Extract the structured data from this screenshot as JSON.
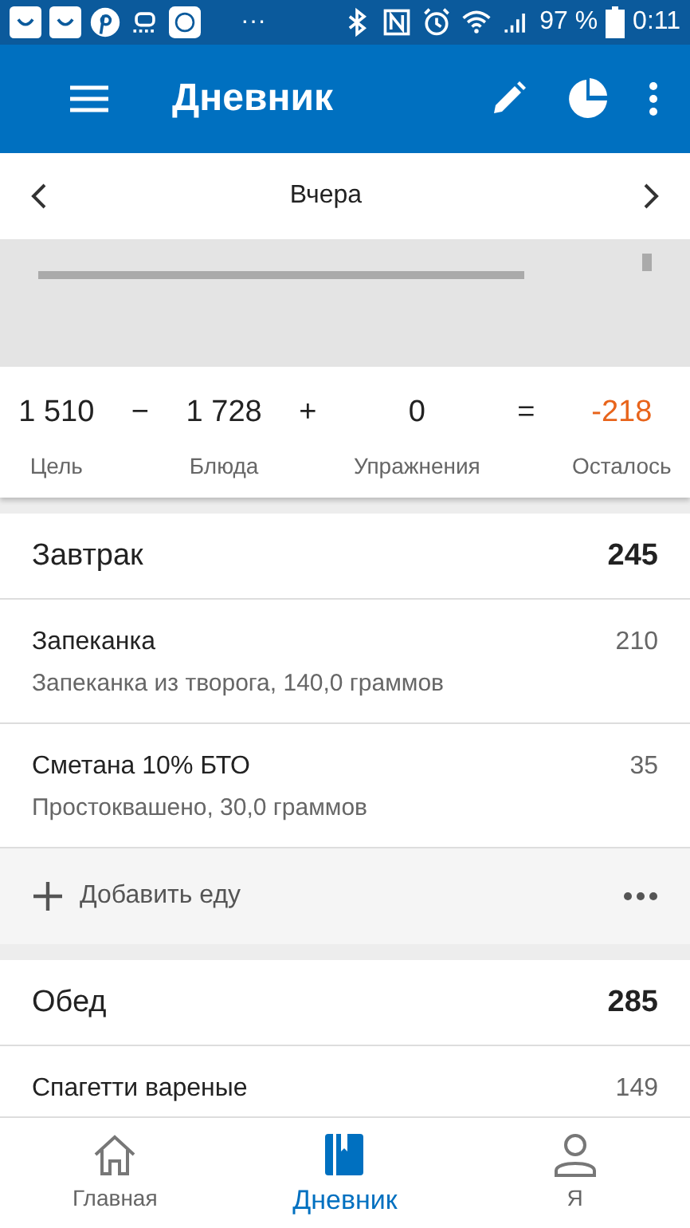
{
  "status_bar": {
    "battery": "97 %",
    "time": "0:11",
    "overflow": "···"
  },
  "app_bar": {
    "title": "Дневник"
  },
  "date_nav": {
    "label": "Вчера"
  },
  "summary": {
    "items": [
      {
        "kind": "value",
        "value": "1 510",
        "label": "Цель"
      },
      {
        "kind": "operator",
        "value": "−"
      },
      {
        "kind": "value",
        "value": "1 728",
        "label": "Блюда"
      },
      {
        "kind": "operator",
        "value": "+"
      },
      {
        "kind": "value",
        "value": "0",
        "label": "Упражнения"
      },
      {
        "kind": "operator",
        "value": "="
      },
      {
        "kind": "result",
        "value": "-218",
        "label": "Осталось"
      }
    ]
  },
  "meals": [
    {
      "name": "Завтрак",
      "total": "245",
      "entries": [
        {
          "name": "Запеканка",
          "detail": "Запеканка из творога, 140,0 граммов",
          "calories": "210"
        },
        {
          "name": "Сметана 10% БТО",
          "detail": "Простоквашено, 30,0 граммов",
          "calories": "35"
        }
      ],
      "add_label": "Добавить еду"
    },
    {
      "name": "Обед",
      "total": "285",
      "entries": [
        {
          "name": "Спагетти вареные",
          "calories": "149"
        }
      ]
    }
  ],
  "bottom_nav": [
    {
      "label": "Главная",
      "kind": "home",
      "selected": false
    },
    {
      "label": "Дневник",
      "kind": "diary",
      "selected": true
    },
    {
      "label": "Я",
      "kind": "profile",
      "selected": false
    }
  ]
}
